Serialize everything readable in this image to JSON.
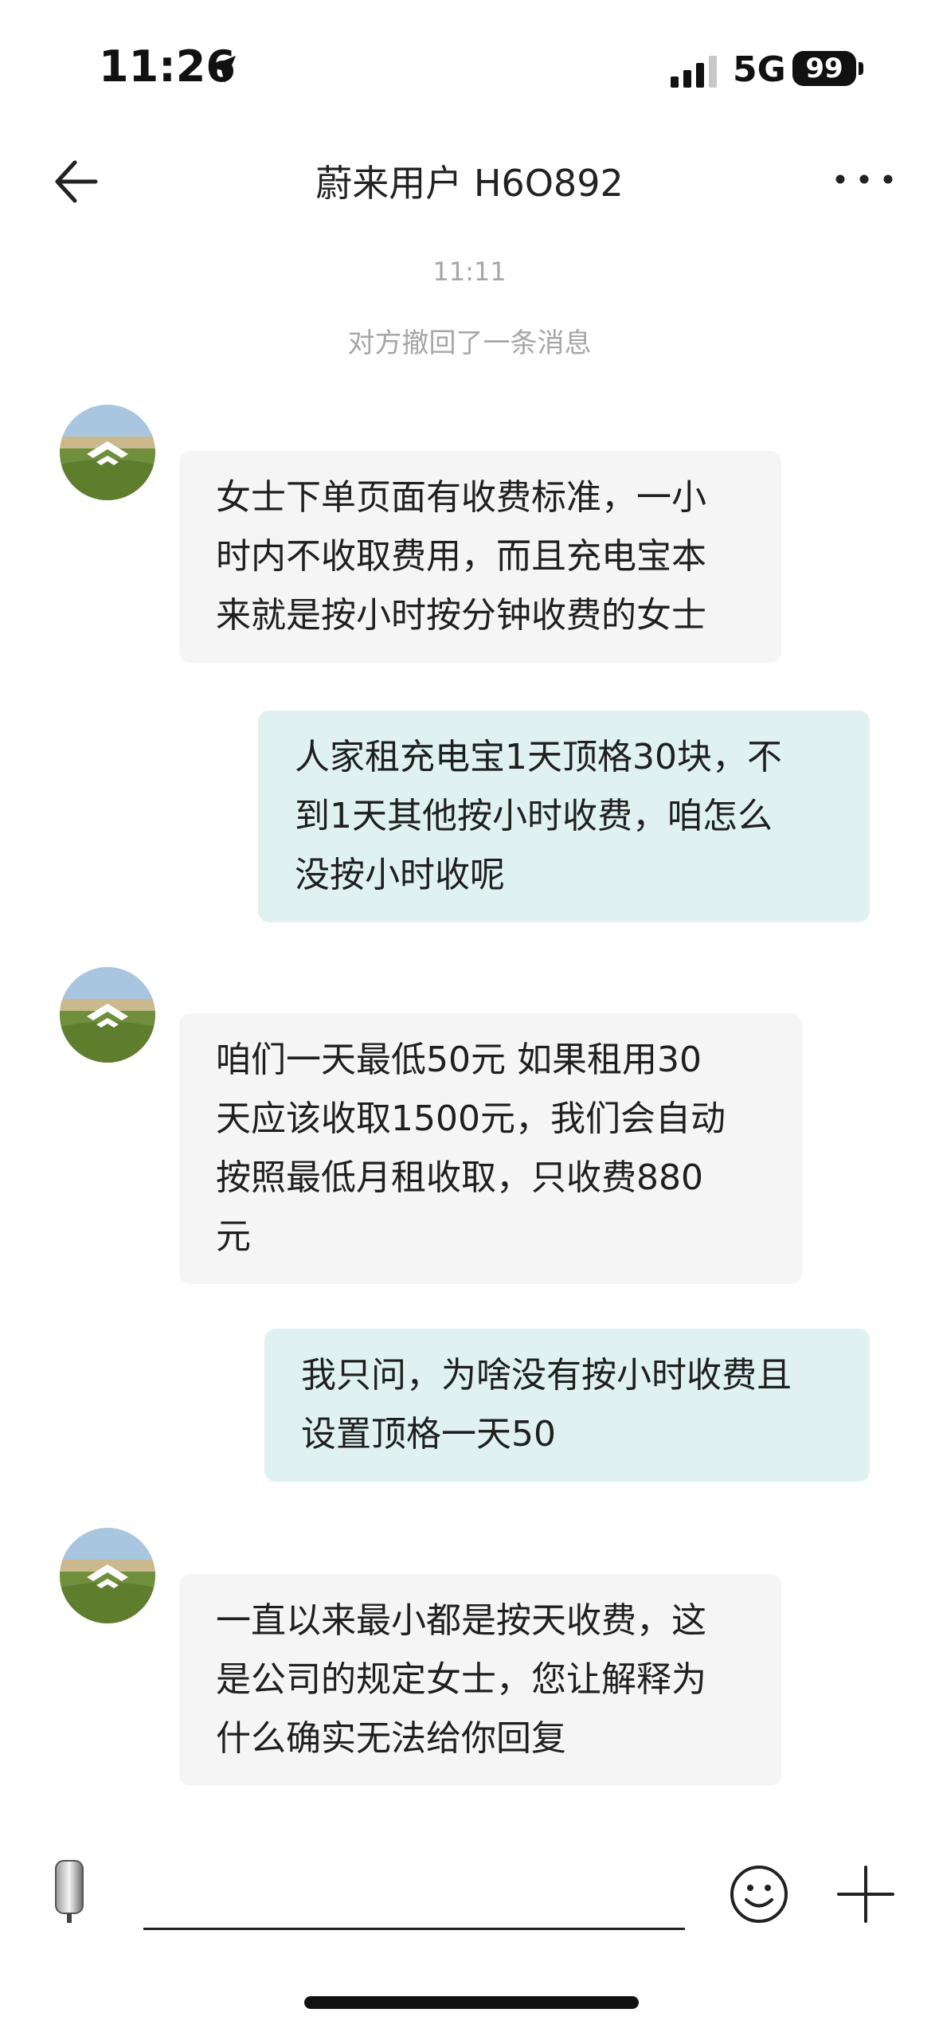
{
  "status_bar": {
    "time": "11:26",
    "network": "5G",
    "battery": "99"
  },
  "nav": {
    "title": "蔚来用户 H6O892"
  },
  "chat": {
    "timestamp": "11:11",
    "recall_notice": "对方撤回了一条消息",
    "messages": [
      {
        "side": "incoming",
        "lines": [
          "女士下单页面有收费标准，一小",
          "时内不收取费用，而且充电宝本",
          "来就是按小时按分钟收费的女士"
        ]
      },
      {
        "side": "outgoing",
        "lines": [
          "人家租充电宝1天顶格30块，不",
          "到1天其他按小时收费，咱怎么",
          "没按小时收呢"
        ]
      },
      {
        "side": "incoming",
        "lines": [
          "咱们一天最低50元  如果租用30",
          "天应该收取1500元，我们会自动",
          "按照最低月租收取，只收费880",
          "元"
        ]
      },
      {
        "side": "outgoing",
        "lines": [
          "我只问，为啥没有按小时收费且",
          "设置顶格一天50"
        ]
      },
      {
        "side": "incoming",
        "lines": [
          "一直以来最小都是按天收费，这",
          "是公司的规定女士，您让解释为",
          "什么确实无法给你回复"
        ]
      }
    ]
  },
  "input": {
    "placeholder": ""
  },
  "icons": {
    "back": "back-arrow-icon",
    "more": "more-icon",
    "voice": "microphone-icon",
    "emoji": "emoji-icon",
    "plus": "plus-icon"
  },
  "colors": {
    "incoming_bubble": "#f5f5f5",
    "outgoing_bubble": "#dff1f1",
    "system_text": "#a6a6a6"
  }
}
